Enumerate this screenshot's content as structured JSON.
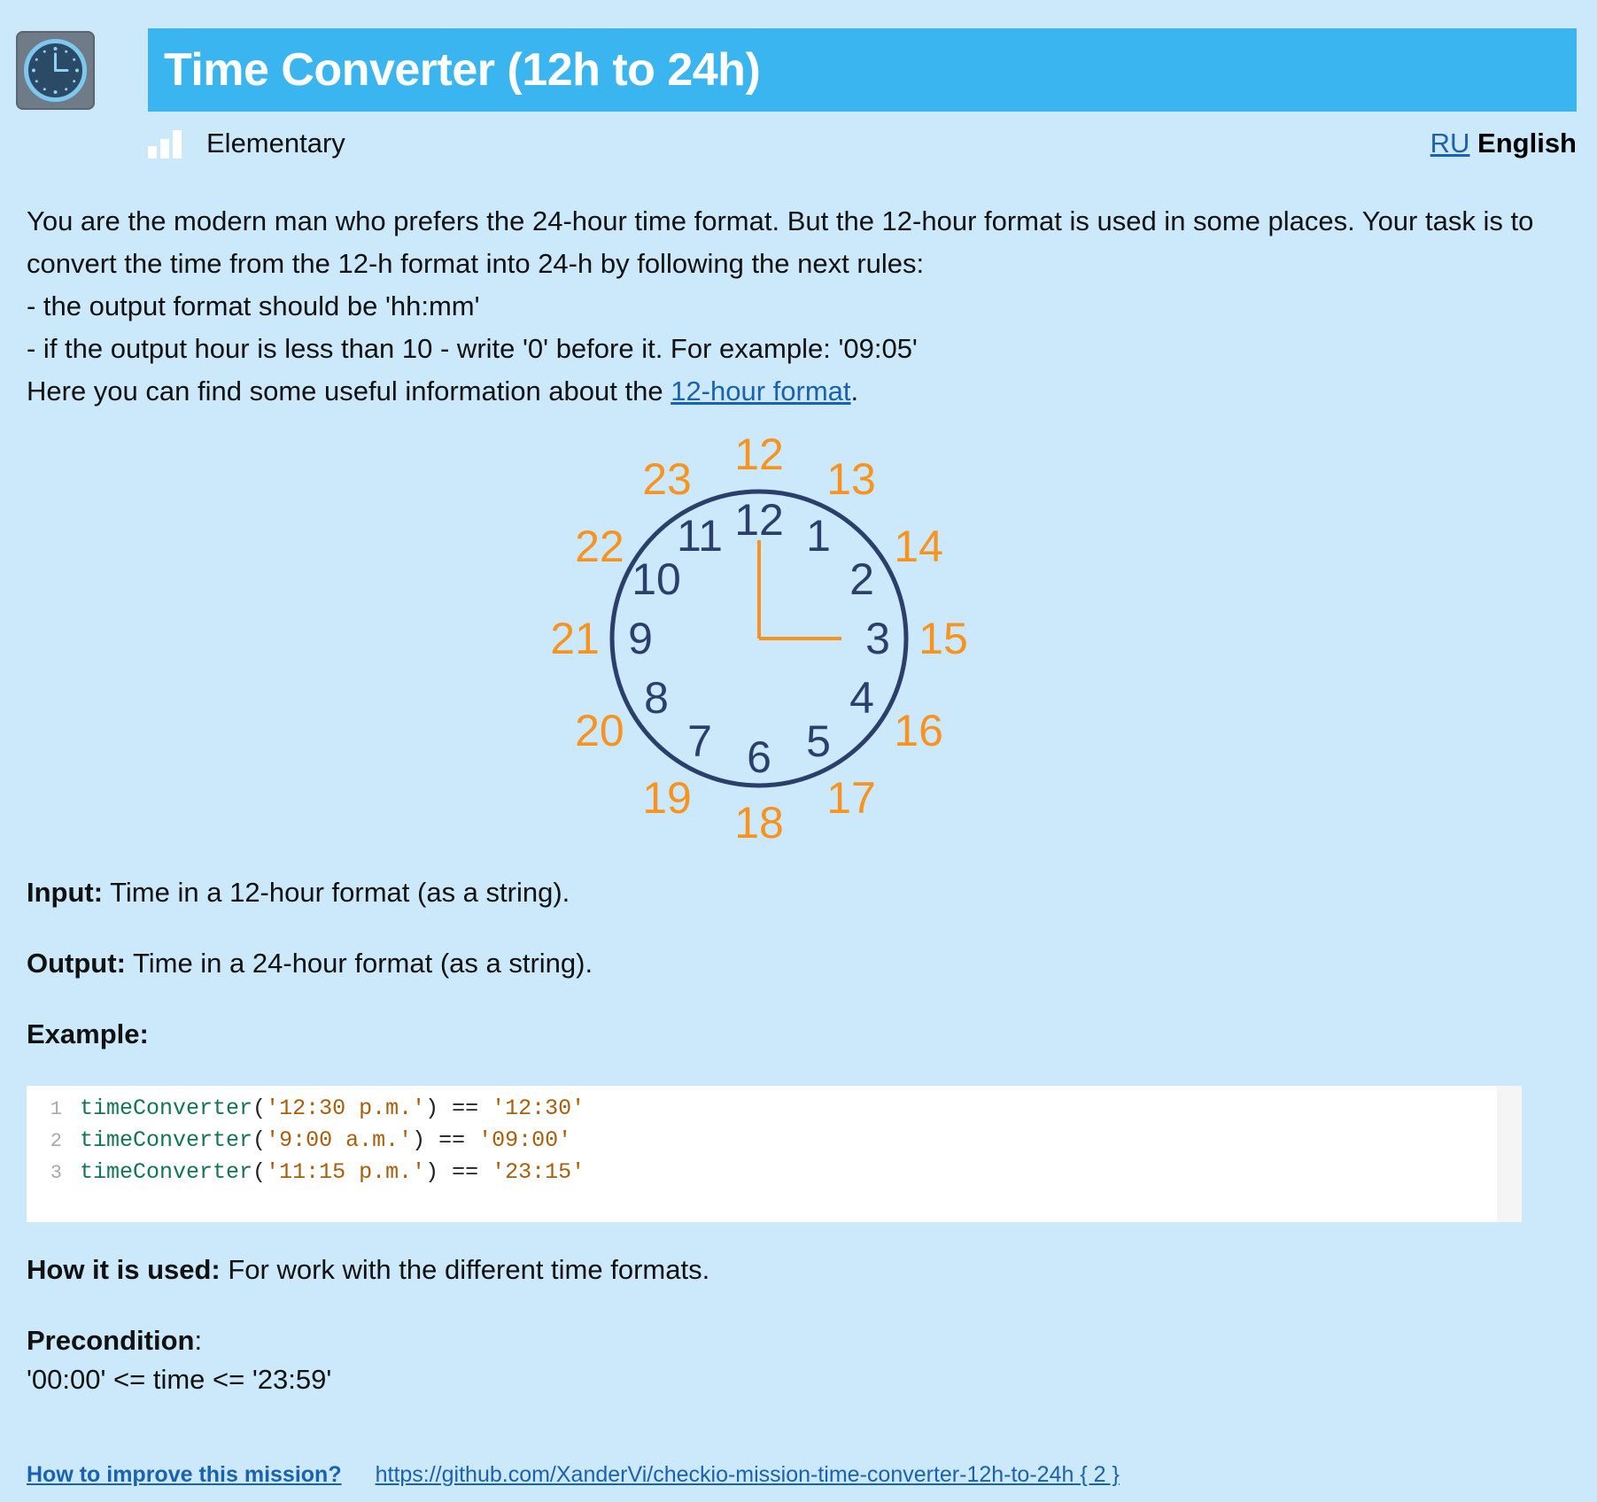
{
  "header": {
    "title": "Time Converter (12h to 24h)",
    "icon": "clock-icon"
  },
  "level": {
    "label": "Elementary",
    "icon": "level-bars-icon"
  },
  "language": {
    "ru_label": "RU",
    "en_label": "English"
  },
  "description": {
    "line1": "You are the modern man who prefers the 24-hour time format. But the 12-hour format is used in some places. Your task is to convert the time from the 12-h format into 24-h by following the next rules:",
    "rule1": "- the output format should be 'hh:mm'",
    "rule2": "- if the output hour is less than 10 - write '0' before it. For example: '09:05'",
    "info_prefix": "Here you can find some useful information about the ",
    "info_link": "12-hour format",
    "info_suffix": "."
  },
  "clock": {
    "inner_numbers": [
      "12",
      "1",
      "2",
      "3",
      "4",
      "5",
      "6",
      "7",
      "8",
      "9",
      "10",
      "11"
    ],
    "outer_numbers": [
      "12",
      "13",
      "14",
      "15",
      "16",
      "17",
      "18",
      "19",
      "20",
      "21",
      "22",
      "23"
    ],
    "inner_color": "#2c3e6b",
    "outer_color": "#f7931e",
    "hand_color": "#f7931e"
  },
  "input": {
    "label": "Input:",
    "text": " Time in a 12-hour format (as a string)."
  },
  "output": {
    "label": "Output:",
    "text": " Time in a 24-hour format (as a string)."
  },
  "example": {
    "label": "Example:",
    "lines": [
      {
        "num": "1",
        "fn": "timeConverter",
        "arg": "'12:30 p.m.'",
        "op": " == ",
        "result": "'12:30'"
      },
      {
        "num": "2",
        "fn": "timeConverter",
        "arg": "'9:00 a.m.'",
        "op": " == ",
        "result": "'09:00'"
      },
      {
        "num": "3",
        "fn": "timeConverter",
        "arg": "'11:15 p.m.'",
        "op": " == ",
        "result": "'23:15'"
      }
    ]
  },
  "usage": {
    "label": "How it is used:",
    "text": " For work with the different time formats."
  },
  "precondition": {
    "label": "Precondition",
    "colon": ":",
    "text": "'00:00' <= time <= '23:59'"
  },
  "footer": {
    "improve_label": "How to improve this mission?",
    "repo_link": "https://github.com/XanderVi/checkio-mission-time-converter-12h-to-24h { 2 }"
  }
}
